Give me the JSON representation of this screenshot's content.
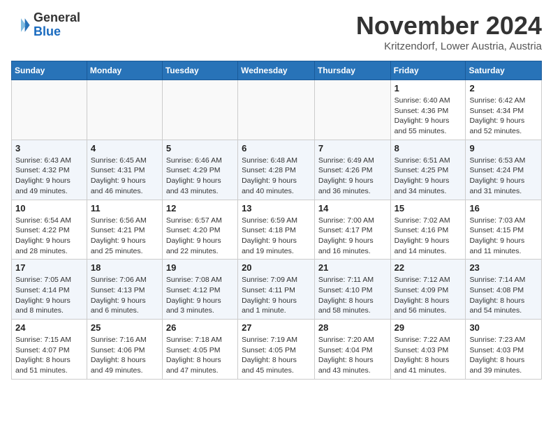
{
  "logo": {
    "general": "General",
    "blue": "Blue"
  },
  "title": "November 2024",
  "subtitle": "Kritzendorf, Lower Austria, Austria",
  "days_of_week": [
    "Sunday",
    "Monday",
    "Tuesday",
    "Wednesday",
    "Thursday",
    "Friday",
    "Saturday"
  ],
  "weeks": [
    [
      {
        "day": "",
        "info": ""
      },
      {
        "day": "",
        "info": ""
      },
      {
        "day": "",
        "info": ""
      },
      {
        "day": "",
        "info": ""
      },
      {
        "day": "",
        "info": ""
      },
      {
        "day": "1",
        "info": "Sunrise: 6:40 AM\nSunset: 4:36 PM\nDaylight: 9 hours and 55 minutes."
      },
      {
        "day": "2",
        "info": "Sunrise: 6:42 AM\nSunset: 4:34 PM\nDaylight: 9 hours and 52 minutes."
      }
    ],
    [
      {
        "day": "3",
        "info": "Sunrise: 6:43 AM\nSunset: 4:32 PM\nDaylight: 9 hours and 49 minutes."
      },
      {
        "day": "4",
        "info": "Sunrise: 6:45 AM\nSunset: 4:31 PM\nDaylight: 9 hours and 46 minutes."
      },
      {
        "day": "5",
        "info": "Sunrise: 6:46 AM\nSunset: 4:29 PM\nDaylight: 9 hours and 43 minutes."
      },
      {
        "day": "6",
        "info": "Sunrise: 6:48 AM\nSunset: 4:28 PM\nDaylight: 9 hours and 40 minutes."
      },
      {
        "day": "7",
        "info": "Sunrise: 6:49 AM\nSunset: 4:26 PM\nDaylight: 9 hours and 36 minutes."
      },
      {
        "day": "8",
        "info": "Sunrise: 6:51 AM\nSunset: 4:25 PM\nDaylight: 9 hours and 34 minutes."
      },
      {
        "day": "9",
        "info": "Sunrise: 6:53 AM\nSunset: 4:24 PM\nDaylight: 9 hours and 31 minutes."
      }
    ],
    [
      {
        "day": "10",
        "info": "Sunrise: 6:54 AM\nSunset: 4:22 PM\nDaylight: 9 hours and 28 minutes."
      },
      {
        "day": "11",
        "info": "Sunrise: 6:56 AM\nSunset: 4:21 PM\nDaylight: 9 hours and 25 minutes."
      },
      {
        "day": "12",
        "info": "Sunrise: 6:57 AM\nSunset: 4:20 PM\nDaylight: 9 hours and 22 minutes."
      },
      {
        "day": "13",
        "info": "Sunrise: 6:59 AM\nSunset: 4:18 PM\nDaylight: 9 hours and 19 minutes."
      },
      {
        "day": "14",
        "info": "Sunrise: 7:00 AM\nSunset: 4:17 PM\nDaylight: 9 hours and 16 minutes."
      },
      {
        "day": "15",
        "info": "Sunrise: 7:02 AM\nSunset: 4:16 PM\nDaylight: 9 hours and 14 minutes."
      },
      {
        "day": "16",
        "info": "Sunrise: 7:03 AM\nSunset: 4:15 PM\nDaylight: 9 hours and 11 minutes."
      }
    ],
    [
      {
        "day": "17",
        "info": "Sunrise: 7:05 AM\nSunset: 4:14 PM\nDaylight: 9 hours and 8 minutes."
      },
      {
        "day": "18",
        "info": "Sunrise: 7:06 AM\nSunset: 4:13 PM\nDaylight: 9 hours and 6 minutes."
      },
      {
        "day": "19",
        "info": "Sunrise: 7:08 AM\nSunset: 4:12 PM\nDaylight: 9 hours and 3 minutes."
      },
      {
        "day": "20",
        "info": "Sunrise: 7:09 AM\nSunset: 4:11 PM\nDaylight: 9 hours and 1 minute."
      },
      {
        "day": "21",
        "info": "Sunrise: 7:11 AM\nSunset: 4:10 PM\nDaylight: 8 hours and 58 minutes."
      },
      {
        "day": "22",
        "info": "Sunrise: 7:12 AM\nSunset: 4:09 PM\nDaylight: 8 hours and 56 minutes."
      },
      {
        "day": "23",
        "info": "Sunrise: 7:14 AM\nSunset: 4:08 PM\nDaylight: 8 hours and 54 minutes."
      }
    ],
    [
      {
        "day": "24",
        "info": "Sunrise: 7:15 AM\nSunset: 4:07 PM\nDaylight: 8 hours and 51 minutes."
      },
      {
        "day": "25",
        "info": "Sunrise: 7:16 AM\nSunset: 4:06 PM\nDaylight: 8 hours and 49 minutes."
      },
      {
        "day": "26",
        "info": "Sunrise: 7:18 AM\nSunset: 4:05 PM\nDaylight: 8 hours and 47 minutes."
      },
      {
        "day": "27",
        "info": "Sunrise: 7:19 AM\nSunset: 4:05 PM\nDaylight: 8 hours and 45 minutes."
      },
      {
        "day": "28",
        "info": "Sunrise: 7:20 AM\nSunset: 4:04 PM\nDaylight: 8 hours and 43 minutes."
      },
      {
        "day": "29",
        "info": "Sunrise: 7:22 AM\nSunset: 4:03 PM\nDaylight: 8 hours and 41 minutes."
      },
      {
        "day": "30",
        "info": "Sunrise: 7:23 AM\nSunset: 4:03 PM\nDaylight: 8 hours and 39 minutes."
      }
    ]
  ]
}
